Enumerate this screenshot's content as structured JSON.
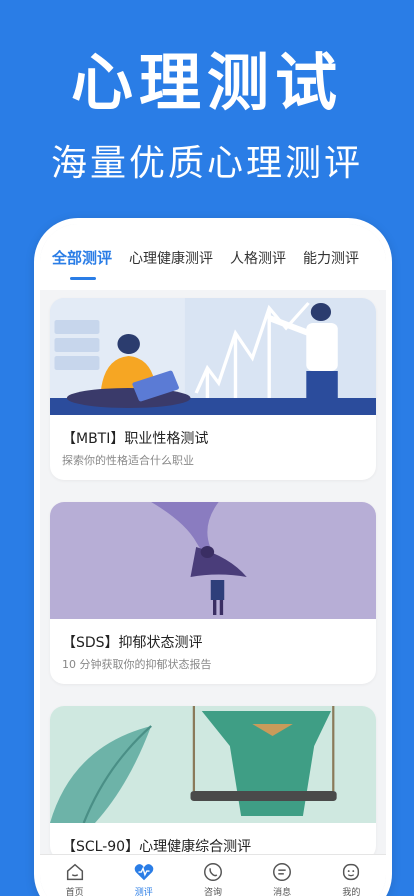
{
  "hero": {
    "title": "心理测试",
    "subtitle": "海量优质心理测评"
  },
  "tabs": [
    {
      "label": "全部测评",
      "active": true
    },
    {
      "label": "心理健康测评",
      "active": false
    },
    {
      "label": "人格测评",
      "active": false
    },
    {
      "label": "能力测评",
      "active": false
    }
  ],
  "cards": [
    {
      "title": "【MBTI】职业性格测试",
      "description": "探索你的性格适合什么职业"
    },
    {
      "title": "【SDS】抑郁状态测评",
      "description": "10 分钟获取你的抑郁状态报告"
    },
    {
      "title": "【SCL-90】心理健康综合测评",
      "description": ""
    }
  ],
  "nav": [
    {
      "label": "首页",
      "icon": "home-icon"
    },
    {
      "label": "测评",
      "icon": "heart-pulse-icon",
      "active": true
    },
    {
      "label": "咨询",
      "icon": "phone-icon"
    },
    {
      "label": "消息",
      "icon": "message-icon"
    },
    {
      "label": "我的",
      "icon": "face-icon"
    }
  ],
  "colors": {
    "brand": "#2a7de6"
  }
}
